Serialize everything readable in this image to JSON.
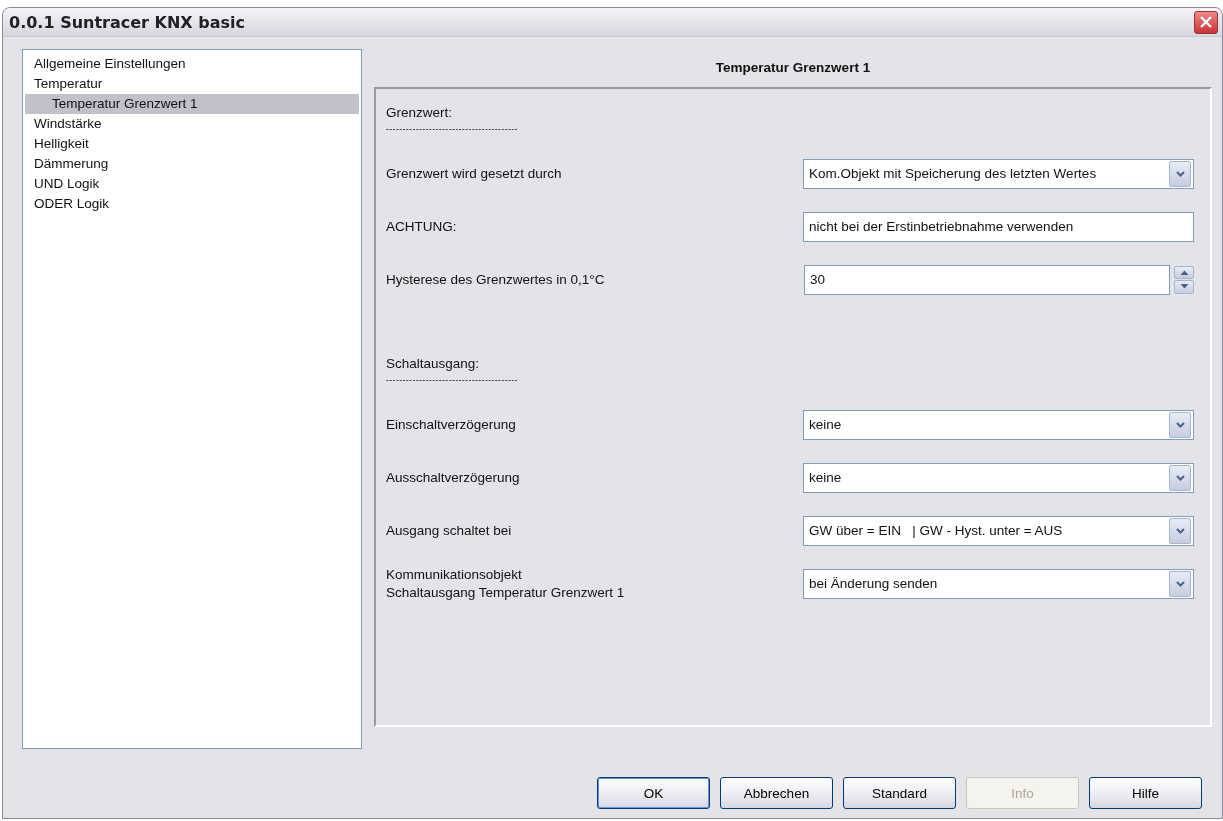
{
  "window": {
    "title": "0.0.1 Suntracer KNX basic"
  },
  "tree": [
    {
      "label": "Allgemeine Einstellungen",
      "selected": false
    },
    {
      "label": "Temperatur",
      "selected": false,
      "children": [
        {
          "label": "Temperatur Grenzwert 1",
          "selected": true
        }
      ]
    },
    {
      "label": "Windstärke",
      "selected": false
    },
    {
      "label": "Helligkeit",
      "selected": false
    },
    {
      "label": "Dämmerung",
      "selected": false
    },
    {
      "label": "UND Logik",
      "selected": false
    },
    {
      "label": "ODER Logik",
      "selected": false
    }
  ],
  "panel": {
    "title": "Temperatur Grenzwert 1",
    "rows": [
      {
        "kind": "heading",
        "label": "Grenzwert:",
        "separator": "----------------------------------------"
      },
      {
        "kind": "select",
        "label": "Grenzwert wird gesetzt durch",
        "value": "Kom.Objekt mit Speicherung des letzten Wertes"
      },
      {
        "kind": "text",
        "label": "ACHTUNG:",
        "value": "nicht bei der Erstinbetriebnahme verwenden"
      },
      {
        "kind": "spin",
        "label": "Hysterese des Grenzwertes in 0,1°C",
        "value": "30"
      },
      {
        "kind": "heading",
        "label": "Schaltausgang:",
        "separator": "----------------------------------------"
      },
      {
        "kind": "select",
        "label": "Einschaltverzögerung",
        "value": "keine"
      },
      {
        "kind": "select",
        "label": "Ausschaltverzögerung",
        "value": "keine"
      },
      {
        "kind": "select",
        "label": "Ausgang schaltet bei",
        "value": "GW über = EIN   | GW - Hyst. unter = AUS"
      },
      {
        "kind": "select",
        "label": "Kommunikationsobjekt\nSchaltausgang Temperatur Grenzwert 1",
        "value": "bei Änderung senden"
      }
    ]
  },
  "buttons": [
    {
      "label": "OK",
      "disabled": false,
      "default": true
    },
    {
      "label": "Abbrechen",
      "disabled": false,
      "default": false
    },
    {
      "label": "Standard",
      "disabled": false,
      "default": false
    },
    {
      "label": "Info",
      "disabled": true,
      "default": false
    },
    {
      "label": "Hilfe",
      "disabled": false,
      "default": false
    }
  ]
}
